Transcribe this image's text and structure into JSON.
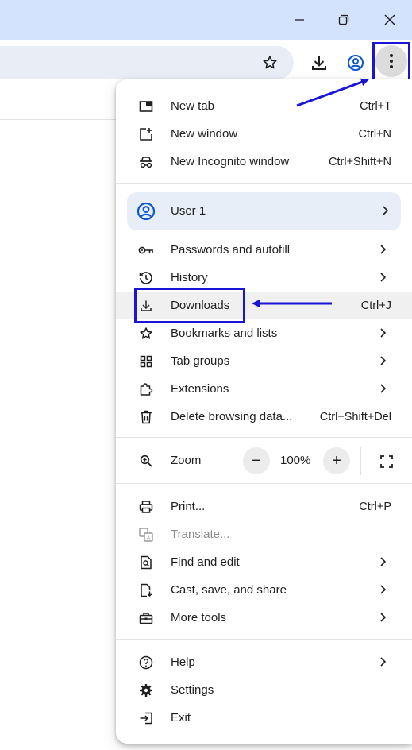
{
  "window": {
    "controls": {
      "minimize_icon": "minimize-icon",
      "restore_icon": "restore-icon",
      "close_icon": "close-icon"
    }
  },
  "toolbar": {
    "icons": [
      "star-icon",
      "download-icon",
      "profile-icon",
      "more-vert-icon"
    ]
  },
  "menu": {
    "group1": [
      {
        "label": "New tab",
        "shortcut": "Ctrl+T",
        "icon": "new-tab-icon"
      },
      {
        "label": "New window",
        "shortcut": "Ctrl+N",
        "icon": "new-window-icon"
      },
      {
        "label": "New Incognito window",
        "shortcut": "Ctrl+Shift+N",
        "icon": "incognito-icon"
      }
    ],
    "profile": {
      "label": "User 1",
      "icon": "account-circle-icon"
    },
    "group2": [
      {
        "label": "Passwords and autofill",
        "shortcut": "",
        "icon": "key-icon",
        "submenu": true
      },
      {
        "label": "History",
        "shortcut": "",
        "icon": "history-icon",
        "submenu": true
      },
      {
        "label": "Downloads",
        "shortcut": "Ctrl+J",
        "icon": "download-icon",
        "submenu": false
      },
      {
        "label": "Bookmarks and lists",
        "shortcut": "",
        "icon": "star-icon",
        "submenu": true
      },
      {
        "label": "Tab groups",
        "shortcut": "",
        "icon": "tab-groups-icon",
        "submenu": true
      },
      {
        "label": "Extensions",
        "shortcut": "",
        "icon": "puzzle-icon",
        "submenu": true
      },
      {
        "label": "Delete browsing data...",
        "shortcut": "Ctrl+Shift+Del",
        "icon": "trash-icon",
        "submenu": false
      }
    ],
    "zoom": {
      "label": "Zoom",
      "value": "100%",
      "minus": "−",
      "plus": "+"
    },
    "group3": [
      {
        "label": "Print...",
        "shortcut": "Ctrl+P",
        "icon": "print-icon"
      },
      {
        "label": "Translate...",
        "shortcut": "",
        "icon": "translate-icon",
        "disabled": true
      },
      {
        "label": "Find and edit",
        "shortcut": "",
        "icon": "find-icon",
        "submenu": true
      },
      {
        "label": "Cast, save, and share",
        "shortcut": "",
        "icon": "cast-save-icon",
        "submenu": true
      },
      {
        "label": "More tools",
        "shortcut": "",
        "icon": "toolbox-icon",
        "submenu": true
      }
    ],
    "group4": [
      {
        "label": "Help",
        "icon": "help-icon",
        "submenu": true
      },
      {
        "label": "Settings",
        "icon": "gear-icon"
      },
      {
        "label": "Exit",
        "icon": "exit-icon"
      }
    ]
  },
  "annotations": {
    "color": "#1a14d6"
  }
}
